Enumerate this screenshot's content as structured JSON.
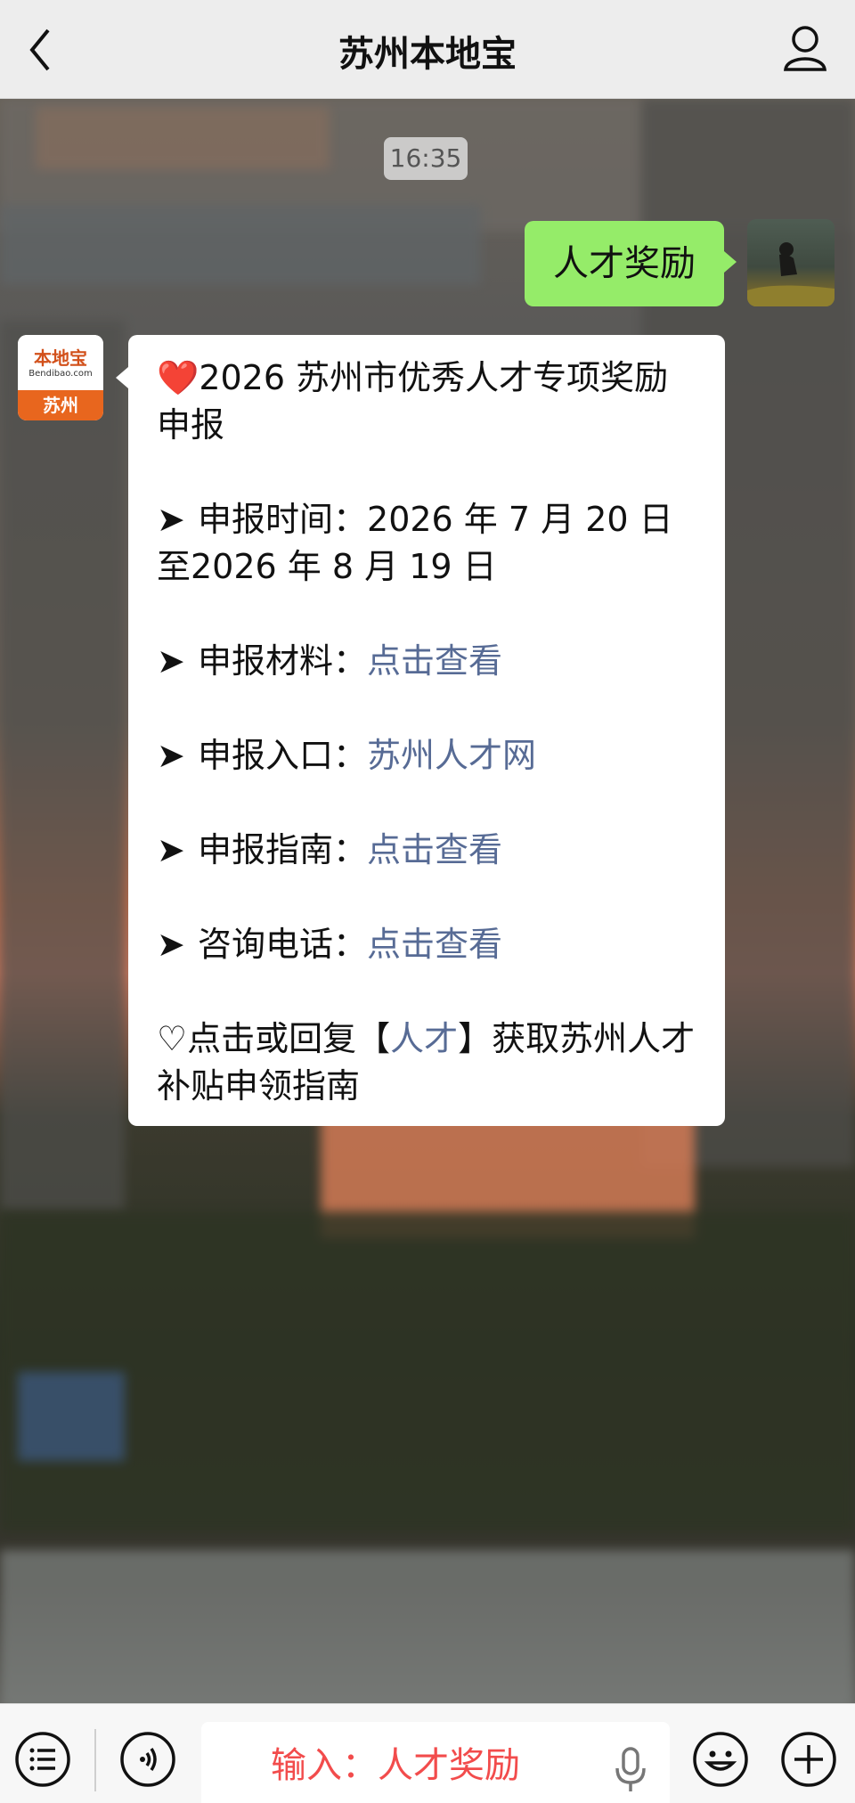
{
  "header": {
    "title": "苏州本地宝",
    "back_icon": "chevron-left-icon",
    "profile_icon": "person-icon"
  },
  "chat": {
    "timestamp": "16:35",
    "user_message": "人才奖励",
    "bot_avatar": {
      "brand": "本地宝",
      "site": "Bendibao.com",
      "city": "苏州"
    },
    "bot_message": {
      "title_icon": "❤️",
      "title": "2026 苏州市优秀人才专项奖励申报",
      "items": [
        {
          "label": "申报时间：",
          "value": "2026 年 7 月 20 日至2026 年 8 月 19 日"
        },
        {
          "label": "申报材料：",
          "link": "点击查看"
        },
        {
          "label": "申报入口：",
          "link": "苏州人才网"
        },
        {
          "label": "申报指南：",
          "link": "点击查看"
        },
        {
          "label": "咨询电话：",
          "link": "点击查看"
        }
      ],
      "arrow": "➤",
      "footer_prefix": "♡点击或回复【",
      "footer_link": "人才",
      "footer_suffix": "】获取苏州人才补贴申领指南"
    }
  },
  "colors": {
    "link": "#576b95",
    "user_bubble": "#95ec69",
    "input_text": "#f24c4c"
  },
  "bottom_bar": {
    "menu_icon": "list-menu-icon",
    "voice_icon": "voice-icon",
    "input_value": "输入：人才奖励",
    "mic_icon": "mic-icon",
    "emoji_icon": "emoji-icon",
    "plus_icon": "plus-icon"
  }
}
